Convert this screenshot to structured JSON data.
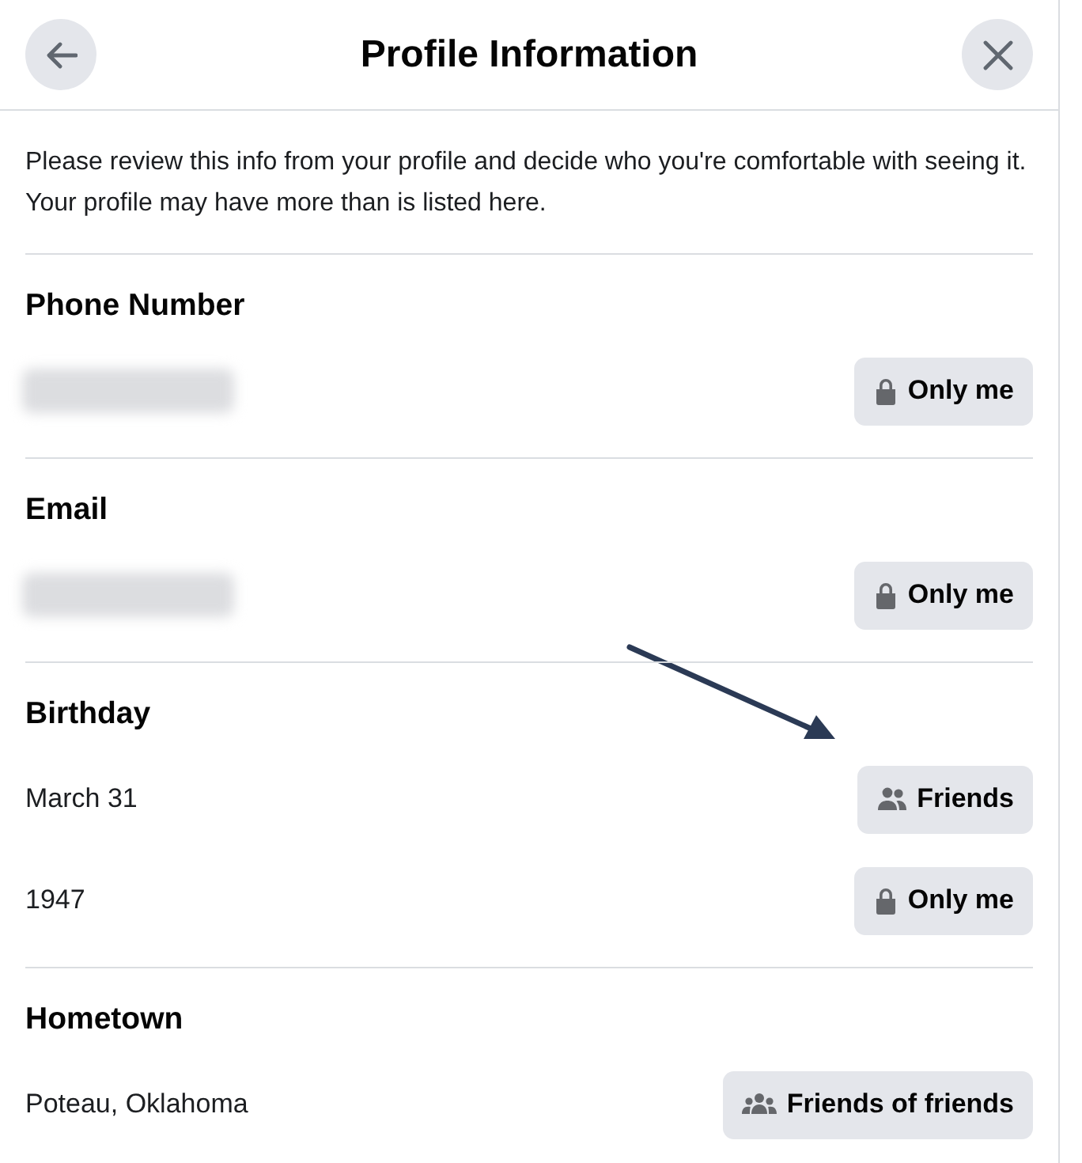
{
  "header": {
    "title": "Profile Information"
  },
  "intro": "Please review this info from your profile and decide who you're comfortable with seeing it. Your profile may have more than is listed here.",
  "sections": [
    {
      "title": "Phone Number",
      "rows": [
        {
          "kind": "redacted",
          "audience": {
            "kind": "lock",
            "label": "Only me"
          }
        }
      ]
    },
    {
      "title": "Email",
      "rows": [
        {
          "kind": "redacted",
          "audience": {
            "kind": "lock",
            "label": "Only me"
          }
        }
      ]
    },
    {
      "title": "Birthday",
      "rows": [
        {
          "kind": "text",
          "value": "March 31",
          "audience": {
            "kind": "friends",
            "label": "Friends"
          }
        },
        {
          "kind": "text",
          "value": "1947",
          "audience": {
            "kind": "lock",
            "label": "Only me"
          }
        }
      ]
    },
    {
      "title": "Hometown",
      "rows": [
        {
          "kind": "text",
          "value": "Poteau, Oklahoma",
          "audience": {
            "kind": "friends_of_friends",
            "label": "Friends of friends"
          }
        }
      ]
    }
  ],
  "annotation_arrow": true
}
